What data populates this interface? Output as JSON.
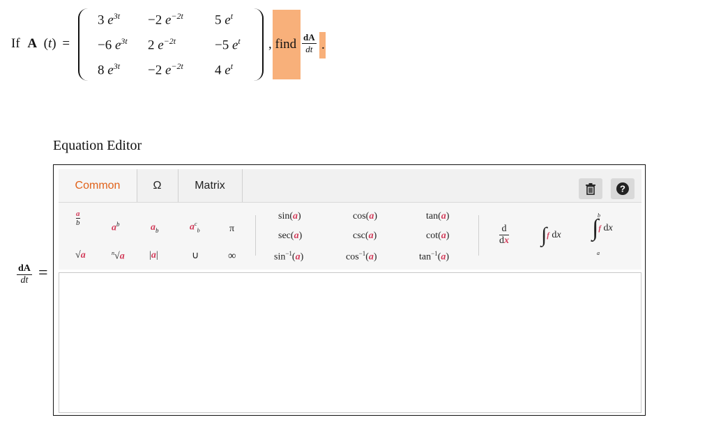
{
  "question": {
    "prefix": "If",
    "func_bold": "A",
    "func_arg": "(t)",
    "equals": "=",
    "matrix": [
      [
        {
          "c": "3",
          "e": "e",
          "p": "3t"
        },
        {
          "c": "−2",
          "e": "e",
          "p": "−2t"
        },
        {
          "c": "5",
          "e": "e",
          "p": "t"
        }
      ],
      [
        {
          "c": "−6",
          "e": "e",
          "p": "3t"
        },
        {
          "c": "2",
          "e": "e",
          "p": "−2t"
        },
        {
          "c": "−5",
          "e": "e",
          "p": "t"
        }
      ],
      [
        {
          "c": "8",
          "e": "e",
          "p": "3t"
        },
        {
          "c": "−2",
          "e": "e",
          "p": "−2t"
        },
        {
          "c": "4",
          "e": "e",
          "p": "t"
        }
      ]
    ],
    "find_text": ", find",
    "deriv_num": "dA",
    "deriv_den": "dt",
    "period": "."
  },
  "editor": {
    "title": "Equation Editor",
    "tabs": [
      "Common",
      "Ω",
      "Matrix"
    ],
    "active_tab": "Common",
    "accent_color": "#e0621a",
    "highlight_color": "#f8b07a",
    "toolbar_icons": [
      "trash-icon",
      "help-icon"
    ],
    "trig": {
      "sin": "sin",
      "cos": "cos",
      "tan": "tan",
      "sec": "sec",
      "csc": "csc",
      "cot": "cot",
      "asin": "sin",
      "acos": "cos",
      "atan": "tan"
    },
    "misc": {
      "pi": "π",
      "infinity": "∞",
      "union": "∪",
      "deriv_d": "d",
      "dx": "d"
    },
    "placeholder_letter": "a",
    "lhs_num": "dA",
    "lhs_den": "dt",
    "lhs_eq": "="
  }
}
